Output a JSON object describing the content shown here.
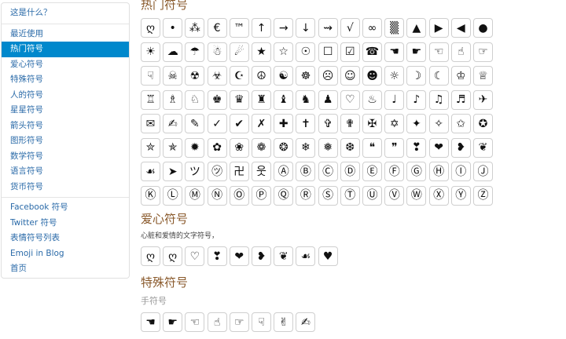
{
  "sidebar": {
    "groups": [
      [
        {
          "label": "这是什么？"
        }
      ],
      [
        {
          "label": "最近使用"
        },
        {
          "label": "热门符号",
          "active": true
        },
        {
          "label": "爱心符号"
        },
        {
          "label": "特殊符号"
        },
        {
          "label": "人的符号"
        },
        {
          "label": "星星符号"
        },
        {
          "label": "箭头符号"
        },
        {
          "label": "图形符号"
        },
        {
          "label": "数学符号"
        },
        {
          "label": "语言符号"
        },
        {
          "label": "货币符号"
        }
      ],
      [
        {
          "label": "Facebook 符号"
        },
        {
          "label": "Twitter 符号"
        },
        {
          "label": "表情符号列表"
        },
        {
          "label": "Emoji in Blog"
        },
        {
          "label": "首页"
        }
      ]
    ]
  },
  "popular": {
    "title": "热门符号",
    "symbols": [
      "ღ",
      "•",
      "⁂",
      "€",
      "™",
      "↑",
      "→",
      "↓",
      "⇝",
      "√",
      "∞",
      "▒",
      "▲",
      "▶",
      "◀",
      "●",
      "☀",
      "☁",
      "☂",
      "☃",
      "☄",
      "★",
      "☆",
      "☉",
      "☐",
      "☑",
      "☎",
      "☚",
      "☛",
      "☜",
      "☝",
      "☞",
      "☟",
      "☠",
      "☢",
      "☣",
      "☪",
      "☮",
      "☯",
      "☸",
      "☹",
      "☺",
      "☻",
      "☼",
      "☽",
      "☾",
      "♔",
      "♕",
      "♖",
      "♗",
      "♘",
      "♚",
      "♛",
      "♜",
      "♝",
      "♞",
      "♟",
      "♡",
      "♨",
      "♩",
      "♪",
      "♫",
      "♬",
      "✈",
      "✉",
      "✍",
      "✎",
      "✓",
      "✔",
      "✗",
      "✚",
      "✝",
      "✞",
      "✟",
      "✠",
      "✡",
      "✦",
      "✧",
      "✩",
      "✪",
      "✮",
      "✯",
      "✹",
      "✿",
      "❀",
      "❁",
      "❂",
      "❄",
      "❅",
      "❆",
      "❝",
      "❞",
      "❣",
      "❤",
      "❥",
      "❦",
      "☙",
      "➤",
      "ツ",
      "㋡",
      "卍",
      "웃",
      "Ⓐ",
      "Ⓑ",
      "Ⓒ",
      "Ⓓ",
      "Ⓔ",
      "Ⓕ",
      "Ⓖ",
      "Ⓗ",
      "Ⓘ",
      "Ⓙ",
      "Ⓚ",
      "Ⓛ",
      "Ⓜ",
      "Ⓝ",
      "Ⓞ",
      "Ⓟ",
      "Ⓠ",
      "Ⓡ",
      "Ⓢ",
      "Ⓣ",
      "Ⓤ",
      "Ⓥ",
      "Ⓦ",
      "Ⓧ",
      "Ⓨ",
      "Ⓩ"
    ]
  },
  "love": {
    "title": "爱心符号",
    "desc": "心脏和爱情的文字符号，",
    "symbols": [
      "ღ",
      "ღ",
      "♡",
      "❣",
      "❤",
      "❥",
      "❦",
      "☙",
      "♥"
    ]
  },
  "special": {
    "title": "特殊符号",
    "subtitle": "手符号",
    "symbols": [
      "☚",
      "☛",
      "☜",
      "☝",
      "☞",
      "☟",
      "✌",
      "✍"
    ]
  }
}
